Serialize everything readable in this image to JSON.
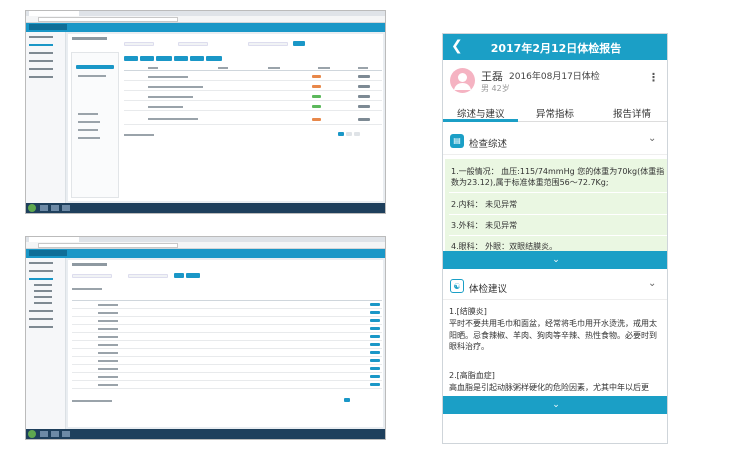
{
  "report": {
    "title": "2017年2月12日体检报告",
    "back_icon": "chevron-left-icon",
    "user_name": "王磊",
    "exam_date": "2016年08月17日体检",
    "gender_age": "男  42岁",
    "more_icon": "vertical-ellipsis-icon",
    "tabs": [
      "综述与建议",
      "异常指标",
      "报告详情"
    ],
    "active_tab": 0,
    "summary_section": {
      "title": "检查综述",
      "lines": [
        "1.一般情况： 血压:115/74mmHg 您的体重为70kg(体重指数为23.12),属于标准体重范围56～72.7Kg;",
        "2.内科： 未见异常",
        "3.外科： 未见异常",
        "4.眼科： 外眼：双眼结膜炎。"
      ]
    },
    "advice_section": {
      "title": "体检建议",
      "paragraphs": [
        "1.[结膜炎]",
        "平时不要共用毛巾和面盆，经常将毛巾用开水烫洗，戒用太阳晒。忌食辣椒、羊肉、狗肉等辛辣、热性食物。必要时到眼科治疗。",
        "2.[高脂血症]",
        "高血脂是引起动脉粥样硬化的危险因素，尤其中年以后更"
      ]
    },
    "expand_icon": "chevron-down-icon",
    "accent_color": "#1b9fc6",
    "summary_bg": "#eaf7e2"
  },
  "desktop_screens": [
    {
      "name": "体检记录",
      "pager": "1 2 3"
    },
    {
      "name": "体检报告查询",
      "pager": "1"
    }
  ]
}
